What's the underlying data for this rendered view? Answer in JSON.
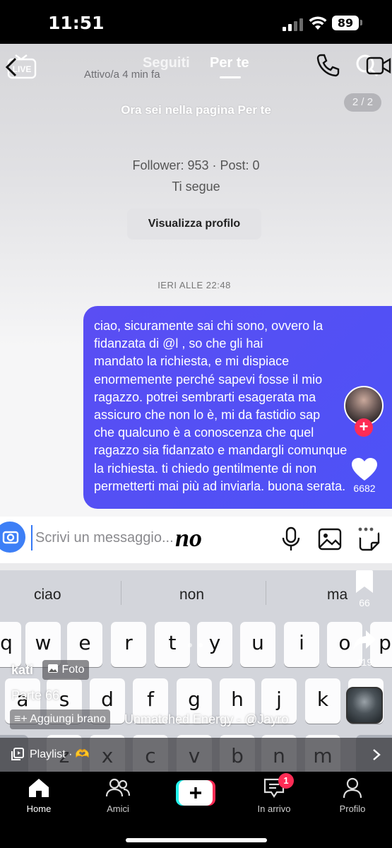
{
  "status_bar": {
    "time": "11:51",
    "battery": "89"
  },
  "tiktok": {
    "tabs": {
      "following": "Seguiti",
      "for_you": "Per te"
    },
    "live_label": "LIVE",
    "page_counter": "2 / 2",
    "toast": "Ora sei nella pagina Per te",
    "likes": "6682",
    "saves": "66",
    "shares": "119",
    "author": "kati",
    "photo_badge": "Foto",
    "caption": "Parte 66",
    "add_song": "Aggiungi brano",
    "song": "Unmatched Energy - @Jayro",
    "playlist": "Playlist · 🫶"
  },
  "chat": {
    "active_status": "Attivo/a 4 min fa",
    "followers": "Follower: 953 · Post: 0",
    "follows_you": "Ti segue",
    "view_profile": "Visualizza profilo",
    "date": "IERI ALLE 22:48",
    "message_lines": [
      "ciao, sicuramente sai chi sono, ovvero la",
      "fidanzata di @l                , so che gli hai",
      "mandato la richiesta, e mi dispiace",
      "enormemente perché sapevi fosse il mio",
      "ragazzo. potrei sembrarti esagerata ma",
      "assicuro che non lo è, mi da fastidio sap",
      "che qualcuno è a conoscenza che quel",
      "ragazzo sia fidanzato e mandargli comunque",
      "la richiesta. ti chiedo gentilmente di non",
      "permetterti mai più ad inviarla. buona serata."
    ],
    "input_placeholder": "Scrivi un messaggio...",
    "sticker_text": "no"
  },
  "keyboard": {
    "suggestions": [
      "ciao",
      "non",
      "ma"
    ],
    "row1": [
      "q",
      "w",
      "e",
      "r",
      "t",
      "y",
      "u",
      "i",
      "o",
      "p"
    ],
    "row2": [
      "a",
      "s",
      "d",
      "f",
      "g",
      "h",
      "j",
      "k",
      "l"
    ],
    "row3": [
      "z",
      "x",
      "c",
      "v",
      "b",
      "n",
      "m"
    ]
  },
  "bottom_nav": {
    "home": "Home",
    "friends": "Amici",
    "inbox": "In arrivo",
    "inbox_badge": "1",
    "profile": "Profilo"
  },
  "colors": {
    "bubble": "#5a4ef3",
    "accent_red": "#fe2c55",
    "camera_blue": "#3d7ff6"
  }
}
